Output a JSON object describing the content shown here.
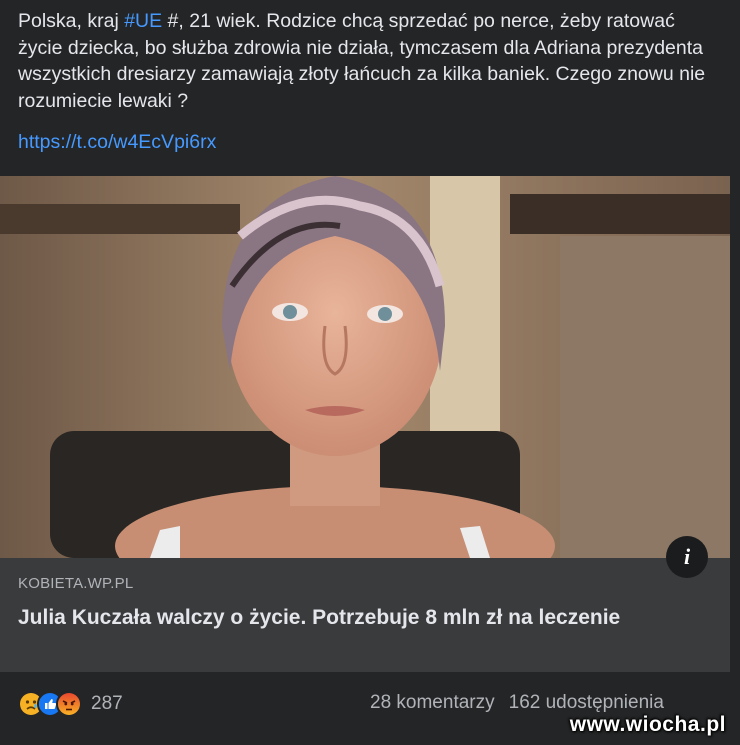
{
  "post": {
    "text_before_hashtag": "Polska, kraj ",
    "hashtag": "#UE",
    "text_after_hashtag": " #, 21 wiek. Rodzice chcą sprzedać po nerce, żeby ratować życie dziecka, bo służba zdrowia nie działa, tymczasem dla Adriana prezydenta wszystkich dresiarzy zamawiają złoty łańcuch za kilka baniek. Czego znowu nie rozumiecie lewaki ?",
    "link": "https://t.co/w4EcVpi6rx"
  },
  "link_preview": {
    "domain": "KOBIETA.WP.PL",
    "title": "Julia Kuczała walczy o życie. Potrzebuje 8 mln zł na leczenie",
    "info_icon": "i"
  },
  "footer": {
    "reaction_icons": [
      "sad-reaction-icon",
      "like-reaction-icon",
      "angry-reaction-icon"
    ],
    "reaction_count": "287",
    "comments": "28 komentarzy",
    "shares": "162 udostępnienia"
  },
  "watermark": "www.wiocha.pl",
  "colors": {
    "background": "#242526",
    "card": "#3a3b3c",
    "link": "#4599ff",
    "text": "#e4e6eb",
    "muted": "#b0b3b8"
  }
}
